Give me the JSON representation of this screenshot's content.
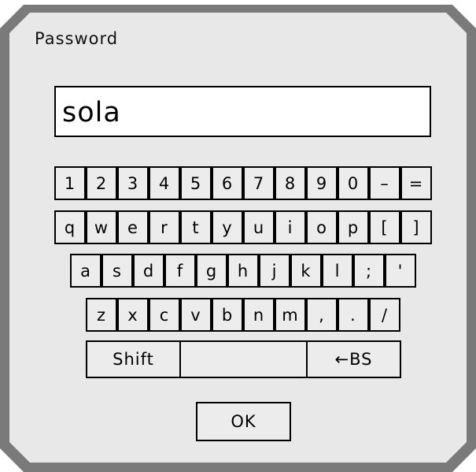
{
  "dialog": {
    "title": "Password",
    "input_value": "sola"
  },
  "keyboard": {
    "row1": [
      "1",
      "2",
      "3",
      "4",
      "5",
      "6",
      "7",
      "8",
      "9",
      "0",
      "–",
      "="
    ],
    "row2": [
      "q",
      "w",
      "e",
      "r",
      "t",
      "y",
      "u",
      "i",
      "o",
      "p",
      "[",
      "]"
    ],
    "row3": [
      "a",
      "s",
      "d",
      "f",
      "g",
      "h",
      "j",
      "k",
      "l",
      ";",
      "'"
    ],
    "row4": [
      "z",
      "x",
      "c",
      "v",
      "b",
      "n",
      "m",
      ",",
      ".",
      "/"
    ],
    "row5": {
      "shift": "Shift",
      "space": "",
      "backspace": "←BS"
    }
  },
  "ok_label": "OK",
  "colors": {
    "frame": "#7a7a7a",
    "panel": "#e8e8e8",
    "key": "#ececec",
    "border": "#000000"
  }
}
